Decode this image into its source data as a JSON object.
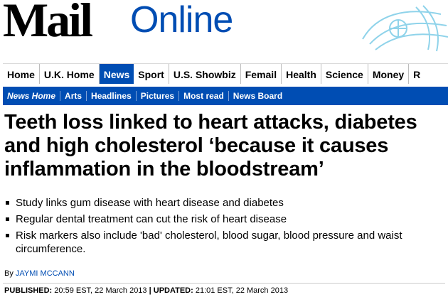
{
  "masthead": {
    "logo_mail": "Mail",
    "logo_online": "Online"
  },
  "nav": {
    "items": [
      {
        "label": "Home"
      },
      {
        "label": "U.K. Home"
      },
      {
        "label": "News",
        "active": true
      },
      {
        "label": "Sport"
      },
      {
        "label": "U.S. Showbiz"
      },
      {
        "label": "Femail"
      },
      {
        "label": "Health"
      },
      {
        "label": "Science"
      },
      {
        "label": "Money"
      },
      {
        "label": "R"
      }
    ]
  },
  "subnav": {
    "items": [
      {
        "label": "News Home",
        "active": true
      },
      {
        "label": "Arts"
      },
      {
        "label": "Headlines"
      },
      {
        "label": "Pictures"
      },
      {
        "label": "Most read"
      },
      {
        "label": "News Board"
      }
    ]
  },
  "article": {
    "headline": "Teeth loss linked to heart attacks, diabetes and high cholesterol ‘because it causes inflammation in the bloodstream’",
    "bullets": [
      "Study links gum disease with heart disease and diabetes",
      "Regular dental treatment can cut the risk of heart disease",
      "Risk markers also include 'bad' cholesterol, blood sugar, blood pressure and waist circumference."
    ],
    "byline_prefix": "By",
    "author": "JAYMI MCCANN",
    "published_label": "PUBLISHED:",
    "published_value": "20:59 EST, 22 March 2013",
    "separator": "|",
    "updated_label": "UPDATED:",
    "updated_value": "21:01 EST, 22 March 2013"
  },
  "colors": {
    "brand_blue": "#004db3",
    "logo_text": "#000000"
  }
}
